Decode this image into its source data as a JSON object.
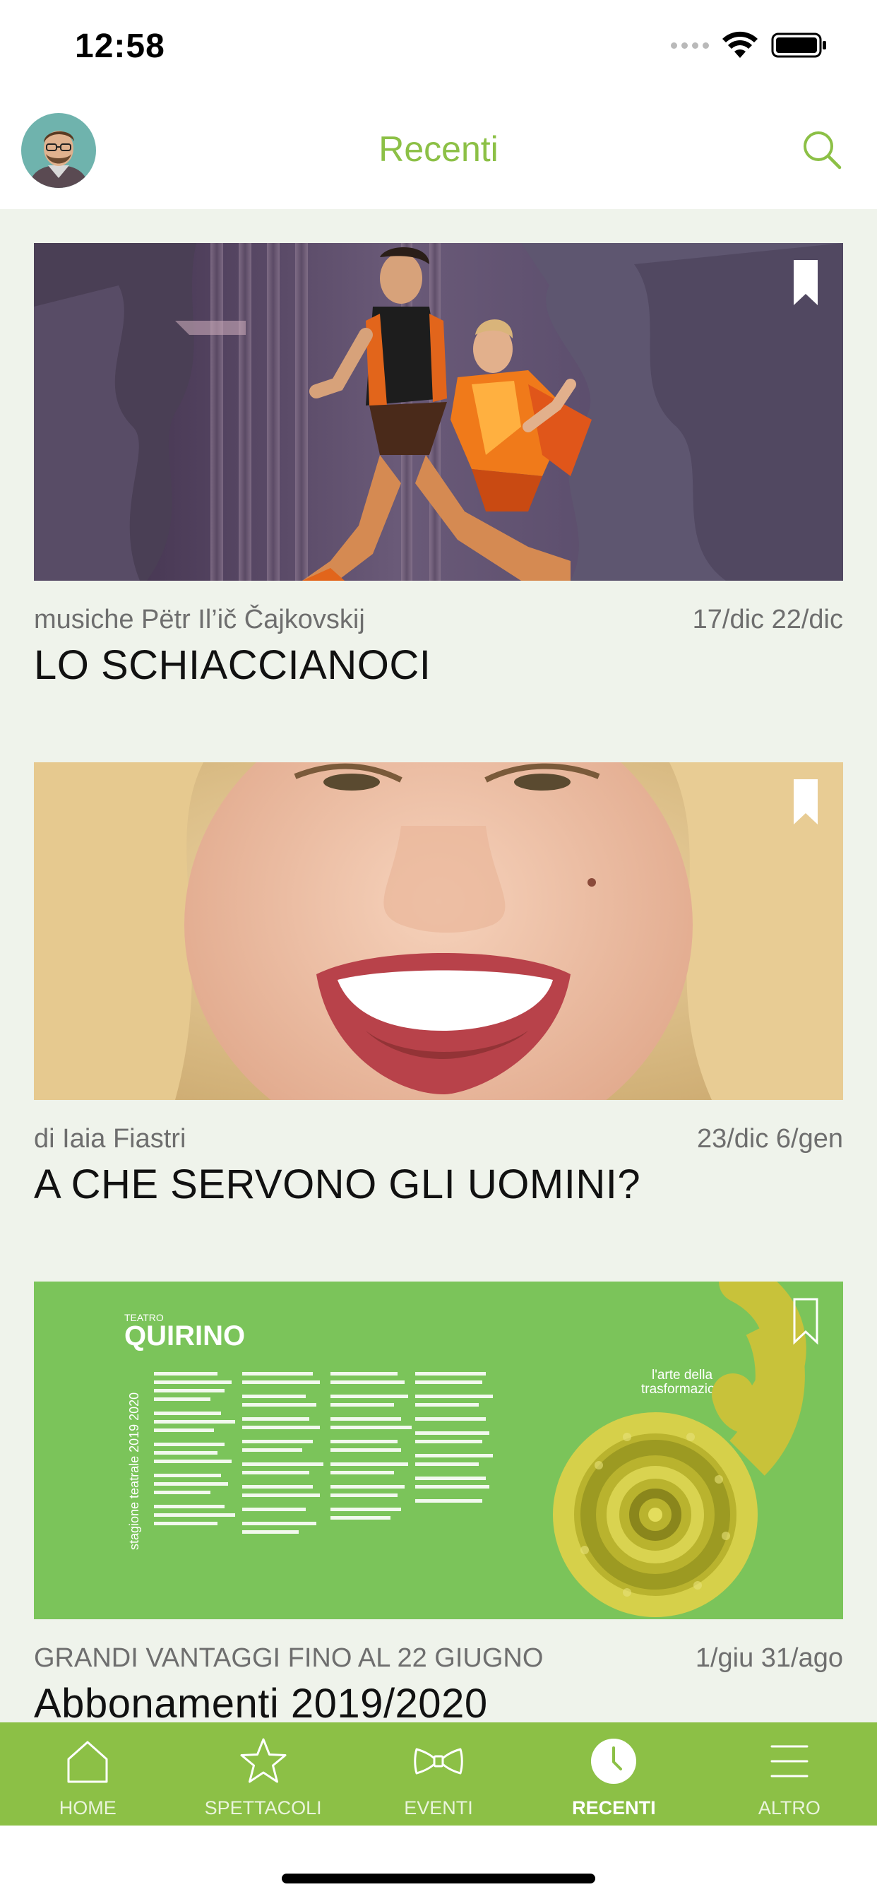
{
  "status_bar": {
    "time": "12:58"
  },
  "header": {
    "title": "Recenti"
  },
  "cards": [
    {
      "subtitle": "musiche Pëtr Il’ič Čajkovskij",
      "dates": "17/dic 22/dic",
      "title": "LO SCHIACCIANOCI",
      "image": "ballet-dancers-photo"
    },
    {
      "subtitle": "di Iaia Fiastri",
      "dates": "23/dic 6/gen",
      "title": "A CHE SERVONO GLI UOMINI?",
      "image": "smiling-woman-photo"
    },
    {
      "subtitle": "GRANDI VANTAGGI FINO AL 22 GIUGNO",
      "dates": "1/giu 31/ago",
      "title": "Abbonamenti 2019/2020",
      "image": "season-poster",
      "poster": {
        "brand_small": "TEATRO",
        "brand": "QUIRINO",
        "vertical": "stagione teatrale 2019 2020",
        "tagline_1": "l'arte della",
        "tagline_2": "trasformazione"
      }
    }
  ],
  "tabs": [
    {
      "label": "HOME",
      "icon": "home-icon",
      "active": false
    },
    {
      "label": "SPETTACOLI",
      "icon": "star-icon",
      "active": false
    },
    {
      "label": "EVENTI",
      "icon": "bowtie-icon",
      "active": false
    },
    {
      "label": "RECENTI",
      "icon": "clock-icon",
      "active": true
    },
    {
      "label": "ALTRO",
      "icon": "menu-icon",
      "active": false
    }
  ],
  "colors": {
    "accent": "#8cc046",
    "background": "#eff3eb",
    "tab_bar": "#8cc046"
  }
}
